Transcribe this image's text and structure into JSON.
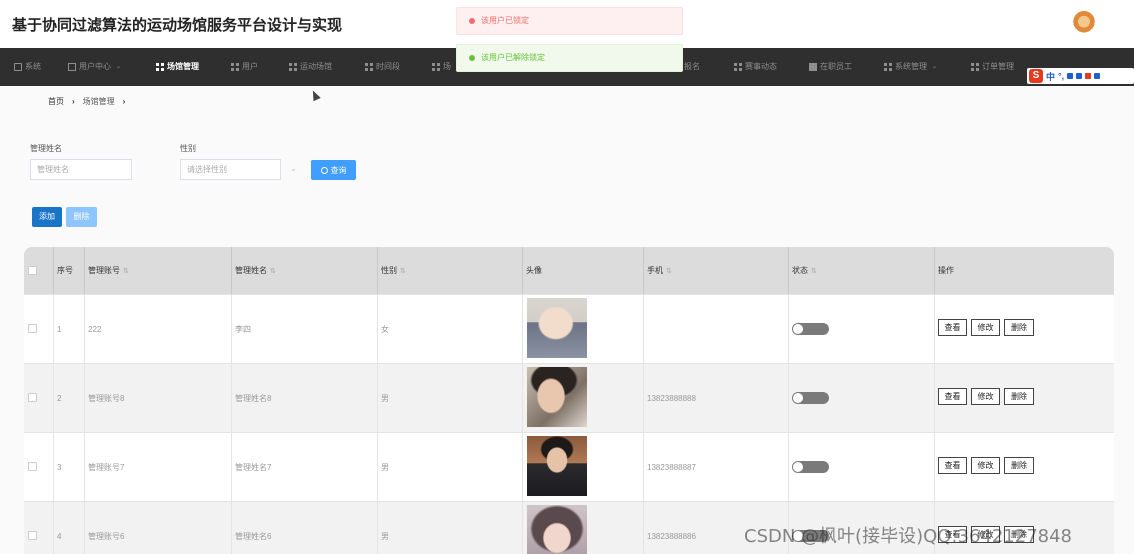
{
  "app": {
    "title": "基于协同过滤算法的运动场馆服务平台设计与实现"
  },
  "nav": {
    "items": [
      {
        "label": "系统",
        "icon": "home-icon",
        "active": false,
        "caret": false
      },
      {
        "label": "用户中心",
        "icon": "user-icon",
        "active": false,
        "caret": true
      },
      {
        "label": "场馆管理",
        "icon": "grid-icon",
        "active": true,
        "caret": false
      },
      {
        "label": "用户",
        "icon": "grid-icon",
        "active": false,
        "caret": false
      },
      {
        "label": "运动场馆",
        "icon": "grid-icon",
        "active": false,
        "caret": false
      },
      {
        "label": "时间段",
        "icon": "grid-icon",
        "active": false,
        "caret": false
      },
      {
        "label": "场",
        "icon": "grid-icon",
        "active": false,
        "caret": false
      },
      {
        "label": "报名",
        "icon": "",
        "active": false,
        "caret": false
      },
      {
        "label": "赛事动态",
        "icon": "list-icon",
        "active": false,
        "caret": false
      },
      {
        "label": "在职员工",
        "icon": "check-icon",
        "active": false,
        "caret": false
      },
      {
        "label": "系统管理",
        "icon": "grid-icon",
        "active": false,
        "caret": true
      },
      {
        "label": "订单管理",
        "icon": "grid-icon",
        "active": false,
        "caret": false
      }
    ]
  },
  "toasts": {
    "error": "该用户已锁定",
    "success": "该用户已解除锁定"
  },
  "ime": {
    "label": "中",
    "punct": "°,"
  },
  "breadcrumb": {
    "home": "首页",
    "current": "场馆管理",
    "sep": "›"
  },
  "search": {
    "name_label": "管理姓名",
    "name_placeholder": "管理姓名",
    "gender_label": "性别",
    "gender_placeholder": "请选择性别",
    "query_button": "查询"
  },
  "actions": {
    "add": "添加",
    "delete": "删除"
  },
  "table": {
    "headers": {
      "index": "序号",
      "account": "管理账号",
      "name": "管理姓名",
      "gender": "性别",
      "avatar": "头像",
      "phone": "手机",
      "status": "状态",
      "ops": "操作"
    },
    "rows": [
      {
        "index": "1",
        "account": "222",
        "name": "李四",
        "gender": "女",
        "phone": "",
        "ops": {
          "view": "查看",
          "edit": "修改",
          "delete": "删除"
        }
      },
      {
        "index": "2",
        "account": "管理账号8",
        "name": "管理姓名8",
        "gender": "男",
        "phone": "13823888888",
        "ops": {
          "view": "查看",
          "edit": "修改",
          "delete": "删除"
        }
      },
      {
        "index": "3",
        "account": "管理账号7",
        "name": "管理姓名7",
        "gender": "男",
        "phone": "13823888887",
        "ops": {
          "view": "查看",
          "edit": "修改",
          "delete": "删除"
        }
      },
      {
        "index": "4",
        "account": "管理账号6",
        "name": "管理姓名6",
        "gender": "男",
        "phone": "13823888886",
        "ops": {
          "view": "查看",
          "edit": "修改",
          "delete": "删除"
        }
      }
    ]
  },
  "watermark": "CSDN @枫叶(接毕设)QQ:3642127848"
}
